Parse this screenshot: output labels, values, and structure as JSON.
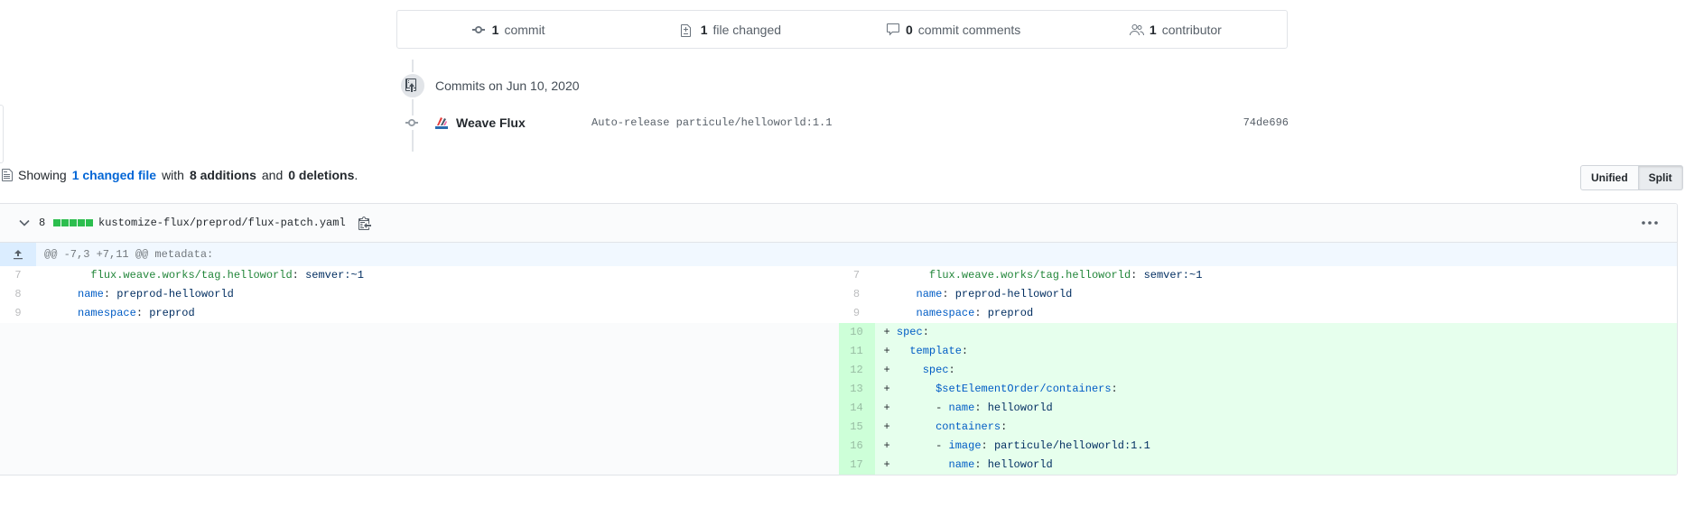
{
  "summary": {
    "commits_count": "1",
    "commits_label": "commit",
    "files_count": "1",
    "files_label": "file changed",
    "comments_count": "0",
    "comments_label": "commit comments",
    "contributors_count": "1",
    "contributors_label": "contributor"
  },
  "commits": {
    "heading": "Commits on Jun 10, 2020",
    "items": [
      {
        "author": "Weave Flux",
        "message": "Auto-release particule/helloworld:1.1",
        "sha": "74de696"
      }
    ]
  },
  "showing": {
    "prefix": "Showing",
    "changed_link": "1 changed file",
    "with": "with",
    "additions": "8 additions",
    "and": "and",
    "deletions": "0 deletions",
    "suffix": "."
  },
  "view_toggle": {
    "unified": "Unified",
    "split": "Split",
    "active": "Split"
  },
  "file": {
    "changes_count": "8",
    "path": "kustomize-flux/preprod/flux-patch.yaml",
    "hunk": "@@ -7,3 +7,11 @@ metadata:",
    "left_lines": [
      {
        "num": "7",
        "indent": "      ",
        "key": "flux.weave.works/tag.helloworld",
        "value": "semver:~1"
      },
      {
        "num": "8",
        "indent": "    ",
        "key": "name",
        "value": "preprod-helloworld"
      },
      {
        "num": "9",
        "indent": "    ",
        "key": "namespace",
        "value": "preprod"
      }
    ],
    "right_lines": [
      {
        "num": "7",
        "prefix": " ",
        "indent": "      ",
        "key": "flux.weave.works/tag.helloworld",
        "value": "semver:~1",
        "added": false
      },
      {
        "num": "8",
        "prefix": " ",
        "indent": "    ",
        "key": "name",
        "value": "preprod-helloworld",
        "added": false
      },
      {
        "num": "9",
        "prefix": " ",
        "indent": "    ",
        "key": "namespace",
        "value": "preprod",
        "added": false
      },
      {
        "num": "10",
        "prefix": "+",
        "indent": " ",
        "key": "spec",
        "value": "",
        "added": true
      },
      {
        "num": "11",
        "prefix": "+",
        "indent": "   ",
        "key": "template",
        "value": "",
        "added": true
      },
      {
        "num": "12",
        "prefix": "+",
        "indent": "     ",
        "key": "spec",
        "value": "",
        "added": true
      },
      {
        "num": "13",
        "prefix": "+",
        "indent": "       ",
        "key": "$setElementOrder/containers",
        "value": "",
        "added": true
      },
      {
        "num": "14",
        "prefix": "+",
        "indent": "       - ",
        "key": "name",
        "value": "helloworld",
        "added": true
      },
      {
        "num": "15",
        "prefix": "+",
        "indent": "       ",
        "key": "containers",
        "value": "",
        "added": true
      },
      {
        "num": "16",
        "prefix": "+",
        "indent": "       - ",
        "key": "image",
        "value": "particule/helloworld:1.1",
        "added": true
      },
      {
        "num": "17",
        "prefix": "+",
        "indent": "         ",
        "key": "name",
        "value": "helloworld",
        "added": true
      }
    ]
  },
  "colors": {
    "addition": "#2cbe4e",
    "link": "#0366d6",
    "added_bg": "#e6ffed"
  }
}
